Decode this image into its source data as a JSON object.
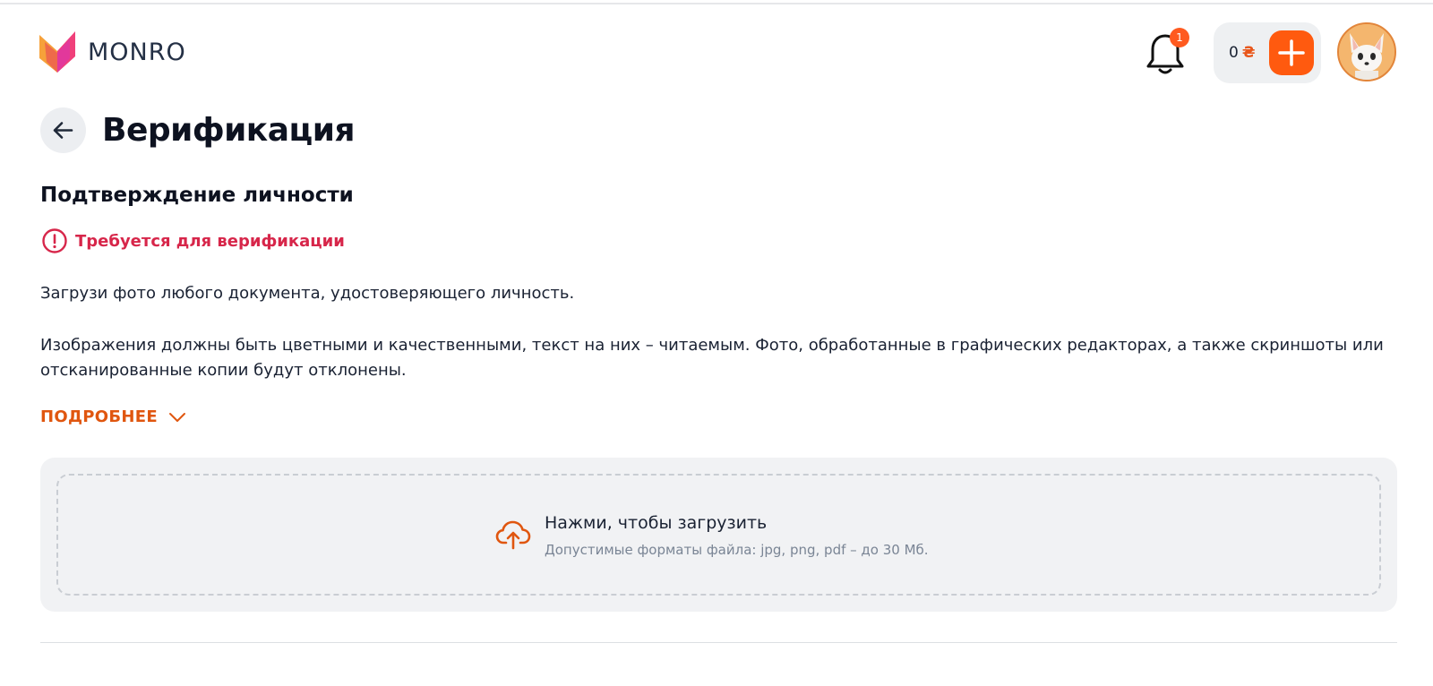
{
  "header": {
    "logo_text": "MONRO",
    "notifications_count": "1",
    "wallet_amount": "0",
    "wallet_currency": "₴"
  },
  "page": {
    "title": "Верификация"
  },
  "identity": {
    "title": "Подтверждение личности",
    "status": "Требуется для верификации",
    "instruction": "Загрузи фото любого документа, удостоверяющего личность.",
    "requirements": "Изображения должны быть цветными и качественными, текст на них – читаемым. Фото, обработанные в графических редакторах, а также скриншоты или отсканированные копии будут отклонены.",
    "more_label": "ПОДРОБНЕЕ"
  },
  "upload": {
    "title": "Нажми, чтобы загрузить",
    "hint": "Допустимые форматы файла: jpg, png, pdf – до 30 Мб."
  },
  "colors": {
    "accent": "#ff5a0f",
    "warning": "#d7264a",
    "link": "#e0560f"
  }
}
